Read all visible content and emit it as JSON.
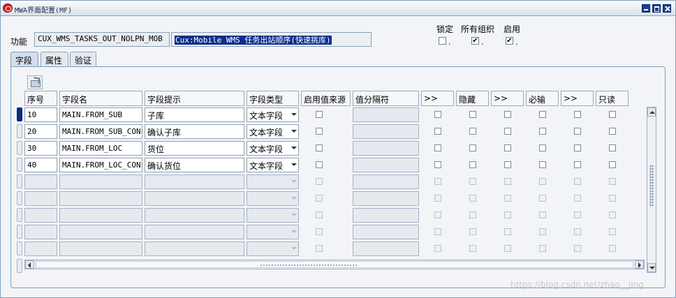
{
  "window": {
    "title": "MWA界面配置(MF)"
  },
  "header": {
    "function_label": "功能",
    "function_code": "CUX_WMS_TASKS_OUT_NOLPN_MOB",
    "function_name": "Cux:Mobile WMS 任务出站顺序(快速挑库)",
    "lock_label": "锁定",
    "all_org_label": "所有组织",
    "enable_label": "启用",
    "lock_checked": false,
    "all_org_checked": true,
    "enable_checked": true
  },
  "tabs": [
    "字段",
    "属性",
    "验证"
  ],
  "active_tab": "字段",
  "columns": [
    "序号",
    "字段名",
    "字段提示",
    "字段类型",
    "启用值来源",
    "值分隔符",
    ">>",
    "隐藏",
    ">>",
    "必输",
    ">>",
    "只读"
  ],
  "rows": [
    {
      "seq": "10",
      "name": "MAIN.FROM_SUB",
      "prompt": "子库",
      "type": "文本字段"
    },
    {
      "seq": "20",
      "name": "MAIN.FROM_SUB_CONFIRM",
      "prompt": "确认子库",
      "type": "文本字段"
    },
    {
      "seq": "30",
      "name": "MAIN.FROM_LOC",
      "prompt": "货位",
      "type": "文本字段"
    },
    {
      "seq": "40",
      "name": "MAIN.FROM_LOC_CONFIRM",
      "prompt": "确认货位",
      "type": "文本字段"
    }
  ],
  "empty_rows": 5,
  "watermark": "https://blog.csdn.net/zhao__jing"
}
